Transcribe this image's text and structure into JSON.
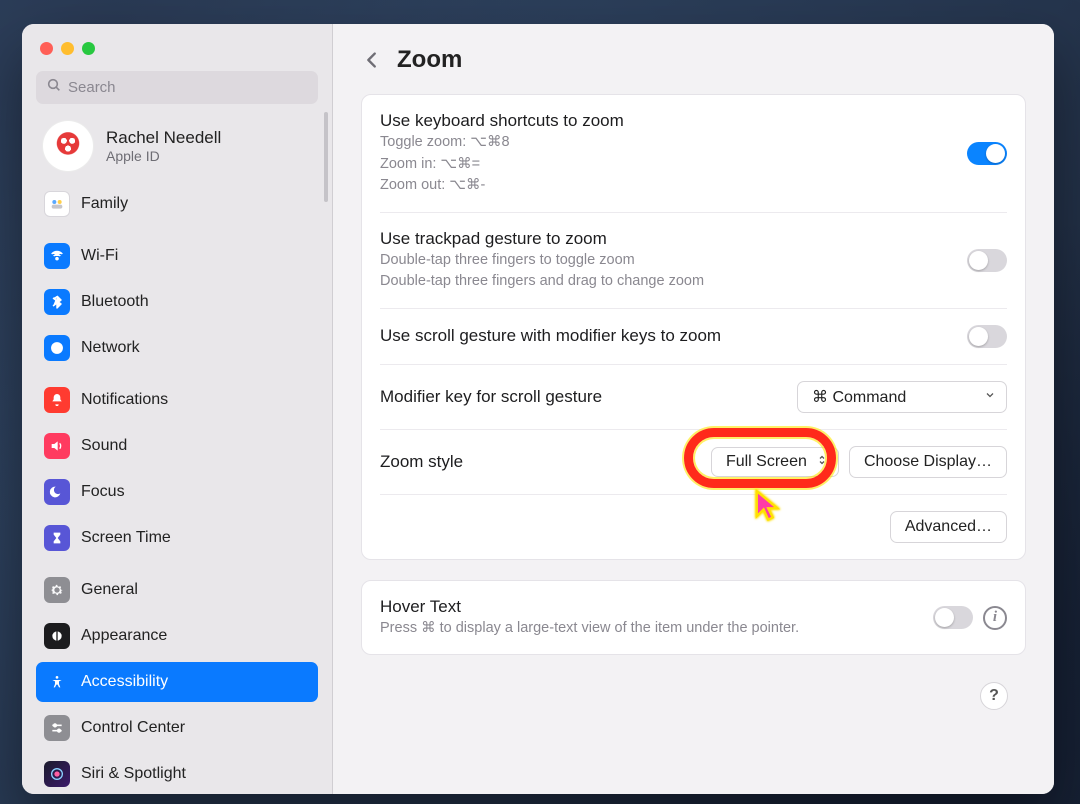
{
  "window": {
    "title": "Zoom"
  },
  "search": {
    "placeholder": "Search"
  },
  "user": {
    "name": "Rachel Needell",
    "sub": "Apple ID"
  },
  "sidebar": {
    "items": [
      {
        "label": "Family"
      },
      {
        "label": "Wi-Fi"
      },
      {
        "label": "Bluetooth"
      },
      {
        "label": "Network"
      },
      {
        "label": "Notifications"
      },
      {
        "label": "Sound"
      },
      {
        "label": "Focus"
      },
      {
        "label": "Screen Time"
      },
      {
        "label": "General"
      },
      {
        "label": "Appearance"
      },
      {
        "label": "Accessibility"
      },
      {
        "label": "Control Center"
      },
      {
        "label": "Siri & Spotlight"
      }
    ]
  },
  "rows": {
    "shortcuts": {
      "title": "Use keyboard shortcuts to zoom",
      "sub1": "Toggle zoom: ⌥⌘8",
      "sub2": "Zoom in: ⌥⌘=",
      "sub3": "Zoom out: ⌥⌘-",
      "on": true
    },
    "trackpad": {
      "title": "Use trackpad gesture to zoom",
      "sub1": "Double-tap three fingers to toggle zoom",
      "sub2": "Double-tap three fingers and drag to change zoom",
      "on": false
    },
    "scroll": {
      "title": "Use scroll gesture with modifier keys to zoom",
      "on": false
    },
    "modifier": {
      "title": "Modifier key for scroll gesture",
      "value": "⌘ Command"
    },
    "zoomstyle": {
      "title": "Zoom style",
      "value": "Full Screen",
      "choose_btn": "Choose Display…"
    },
    "advanced_btn": "Advanced…",
    "hover": {
      "title": "Hover Text",
      "sub": "Press ⌘ to display a large-text view of the item under the pointer.",
      "on": false
    }
  },
  "help_label": "?",
  "colors": {
    "accent": "#0a7aff"
  }
}
